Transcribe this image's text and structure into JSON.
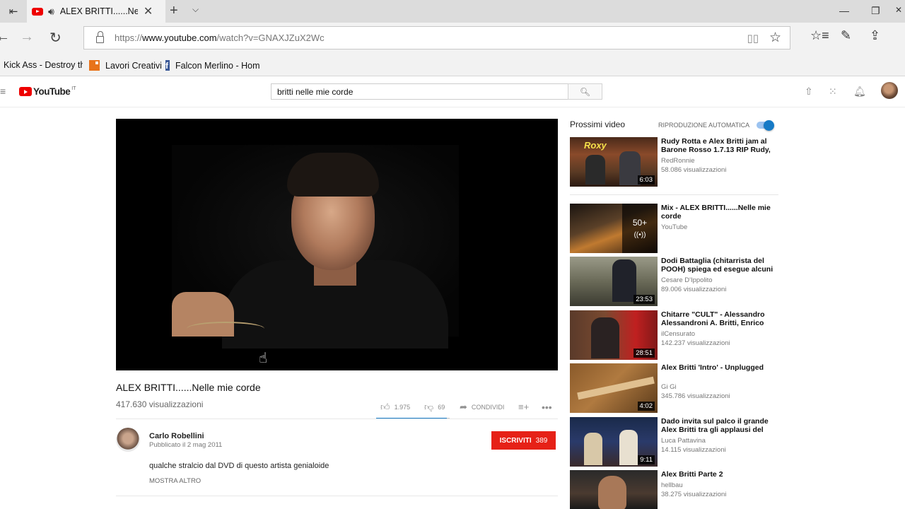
{
  "browser": {
    "tab_title": "ALEX BRITTI......Nelle mie corde",
    "url_prefix": "https://",
    "url_domain": "www.youtube.com",
    "url_path": "/watch?v=GNAXJZuX2Wc",
    "favorites": [
      {
        "label": "Kick Ass - Destroy the"
      },
      {
        "label": "Lavori Creativi"
      },
      {
        "label": "Falcon Merlino - Home"
      }
    ]
  },
  "header": {
    "logo_text": "YouTube",
    "logo_country": "IT",
    "search_value": "britti nelle mie corde"
  },
  "video": {
    "title": "ALEX BRITTI......Nelle mie corde",
    "views": "417.630 visualizzazioni",
    "likes": "1.975",
    "dislikes": "69",
    "share_label": "CONDIVIDI",
    "like_ratio": 0.966
  },
  "owner": {
    "name": "Carlo Robellini",
    "published": "Pubblicato il 2 mag 2011",
    "subscribe_label": "ISCRIVITI",
    "subscribers": "389",
    "description": "qualche stralcio dal DVD di questo artista genialoide",
    "show_more": "MOSTRA ALTRO"
  },
  "sidebar": {
    "next_label": "Prossimi video",
    "autoplay_label": "RIPRODUZIONE AUTOMATICA",
    "autoplay_on": true,
    "videos": [
      {
        "title": "Rudy Rotta e Alex Britti jam al Barone Rosso 1.7.13 RIP Rudy,",
        "channel": "RedRonnie",
        "views": "58.086 visualizzazioni",
        "duration": "6:03"
      },
      {
        "title": "Mix - ALEX BRITTI......Nelle mie corde",
        "channel": "YouTube",
        "views": "",
        "duration": "",
        "mix_count": "50+"
      },
      {
        "title": "Dodi Battaglia (chitarrista del POOH) spiega ed esegue alcuni",
        "channel": "Cesare D'Ippolito",
        "views": "89.006 visualizzazioni",
        "duration": "23:53"
      },
      {
        "title": "Chitarre \"CULT\" - Alessandro Alessandroni A. Britti, Enrico",
        "channel": "ilCensurato",
        "views": "142.237 visualizzazioni",
        "duration": "28:51"
      },
      {
        "title": "Alex Britti 'Intro' - Unplugged",
        "channel": "Gi Gi",
        "views": "345.786 visualizzazioni",
        "duration": "4:02"
      },
      {
        "title": "Dado invita sul palco il grande Alex Britti tra gli applausi del",
        "channel": "Luca Pattavina",
        "views": "14.115 visualizzazioni",
        "duration": "9:11"
      },
      {
        "title": "Alex Britti Parte 2",
        "channel": "hellbau",
        "views": "38.275 visualizzazioni",
        "duration": ""
      }
    ]
  }
}
